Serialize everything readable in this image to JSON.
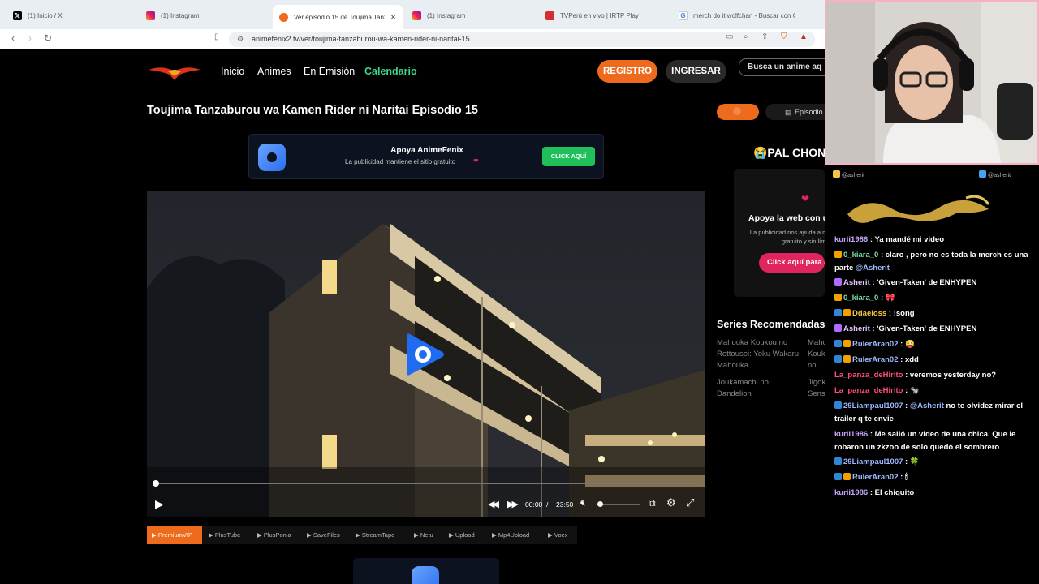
{
  "browser": {
    "tabs": [
      {
        "label": "(1) Inicio / X",
        "icon": "x-logo-icon"
      },
      {
        "label": "(1) Instagram",
        "icon": "instagram-icon"
      },
      {
        "label": "Ver episodio 15 de Toujima Tanz",
        "icon": "animefenix-icon",
        "active": true,
        "close": "×"
      },
      {
        "label": "(1) Instagram",
        "icon": "instagram-icon"
      },
      {
        "label": "TVPerú en vivo | IRTP Play",
        "icon": "tvperu-icon"
      },
      {
        "label": "merch do it wolfchan - Buscar con G",
        "icon": "google-icon"
      }
    ],
    "url": "animefenix2.tv/ver/toujima-tanzaburou-wa-kamen-rider-ni-naritai-15"
  },
  "site": {
    "nav": {
      "links": [
        "Inicio",
        "Animes",
        "En Emisión",
        "Calendario"
      ],
      "register": "REGISTRO",
      "login": "INGRESAR",
      "search_placeholder": "Busca un anime aq"
    },
    "episode_title": "Toujima Tanzaburou wa Kamen Rider ni Naritai Episodio 15",
    "ad": {
      "title": "Apoya AnimeFenix",
      "subtitle": "La publicidad mantiene el sitio gratuito",
      "heart": "❤",
      "button": "CLICK AQUÍ"
    },
    "player": {
      "time_current": "00:00",
      "time_sep": "/",
      "time_total": "23:50"
    },
    "servers": [
      "PremiumVIP",
      "PlusTube",
      "PlusPonia",
      "SaveFiles",
      "StreamTape",
      "Netu",
      "Upload",
      "Mp4Upload",
      "Voex"
    ],
    "side": {
      "episodes_label": "Episodio",
      "pal_chon": "😭PAL CHON",
      "support_title": "Apoya la web con un click",
      "support_text": "La publicidad nos ayuda a mantener el sitio gratuito y sin límites",
      "support_button": "Click aquí para apoyar",
      "recommended_title": "Series Recomendadas",
      "recommended": [
        "Mahouka Koukou no Rettousei: Yoku Wakaru Mahouka",
        "Mahouka Koukou no Rettousei: Yoku Wakaru Mahouka",
        "Joukamachi no Dandelion",
        "Jigoku Sensei Nube OVA"
      ]
    }
  },
  "stream_overlay": {
    "handles": [
      "@asherit_",
      "@asherit_"
    ],
    "chat": [
      {
        "user": "kurii1986",
        "color": "#c9a7ff",
        "msg": ": Ya mandé mi video"
      },
      {
        "user": "0_kiara_0",
        "color": "#7de0a8",
        "msg": ": claro , pero no es toda la merch es una parte ",
        "mention": "@Asherit"
      },
      {
        "user": "Asherit",
        "color": "#e8c3ff",
        "msg": ": 'Given-Taken' de ENHYPEN"
      },
      {
        "user": "0_kiara_0",
        "color": "#7de0a8",
        "msg": ": 🎀"
      },
      {
        "user": "Ddaeloss",
        "color": "#f4c542",
        "msg": ": !song"
      },
      {
        "user": "Asherit",
        "color": "#e8c3ff",
        "msg": ": 'Given-Taken' de ENHYPEN"
      },
      {
        "user": "RulerAran02",
        "color": "#9db8ff",
        "msg": ": 😜"
      },
      {
        "user": "RulerAran02",
        "color": "#9db8ff",
        "msg": ": xdd"
      },
      {
        "user": "La_panza_deHirito",
        "color": "#ff4f7a",
        "msg": ": veremos yesterday no?"
      },
      {
        "user": "La_panza_deHirito",
        "color": "#ff4f7a",
        "msg": ": 🐄"
      },
      {
        "user": "29Liampaul1007",
        "color": "#9db8ff",
        "msg": ": ",
        "mention": "@Asherit",
        "tail": " no te olvidez mirar el trailer q te envie"
      },
      {
        "user": "kurii1986",
        "color": "#c9a7ff",
        "msg": ": Me salió un video de una chica. Que le robaron un zkzoo de solo quedó el sombrero"
      },
      {
        "user": "29Liampaul1007",
        "color": "#9db8ff",
        "msg": ": 🍀"
      },
      {
        "user": "RulerAran02",
        "color": "#9db8ff",
        "msg": ": 🕯"
      },
      {
        "user": "kurii1986",
        "color": "#c9a7ff",
        "msg": ": El chiquito"
      }
    ]
  }
}
